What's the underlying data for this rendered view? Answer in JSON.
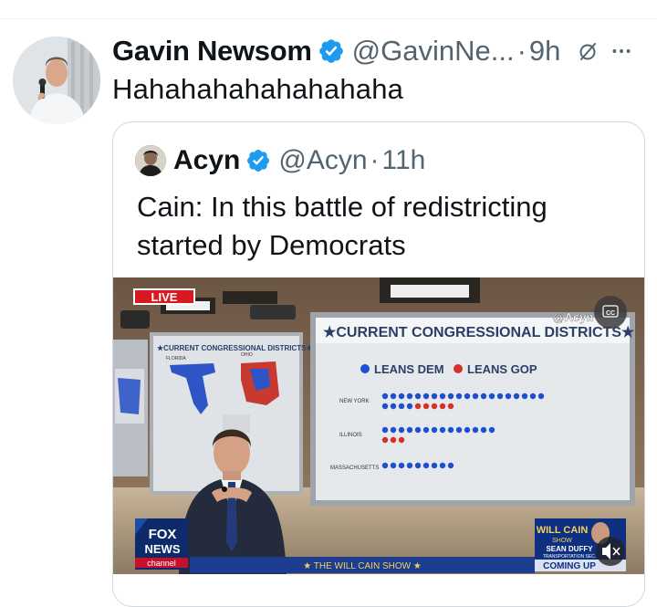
{
  "tweet": {
    "author_name": "Gavin Newsom",
    "handle": "@GavinNe...",
    "time": "9h",
    "separator": "·",
    "text": "Hahahahahahahahaha"
  },
  "quote": {
    "author_name": "Acyn",
    "handle": "@Acyn",
    "separator": "·",
    "time": "11h",
    "text": "Cain: In this battle of redistricting started by Democrats"
  },
  "media": {
    "live_badge": "LIVE",
    "board_title": "★CURRENT CONGRESSIONAL DISTRICTS★",
    "legend_dem": "LEANS DEM",
    "legend_gop": "LEANS GOP",
    "row_new_york": "NEW YORK",
    "row_illinois": "ILLINOIS",
    "row_massachusetts": "MASSACHUSETTS",
    "left_board_title": "★CURRENT CONGRESSIONAL DISTRICTS★",
    "left_board_florida": "FLORIDA",
    "left_board_ohio": "OHIO",
    "watermark": "@Acyn",
    "cc_label": "CC",
    "network_fox": "FOX",
    "network_news": "NEWS",
    "network_channel": "channel",
    "show_banner": "★ THE WILL CAIN SHOW ★",
    "promo_show_a": "WILL CAIN",
    "promo_show_b": "SHOW",
    "promo_guest": "SEAN DUFFY",
    "promo_role": "TRANSPORTATION SEC.",
    "promo_coming": "COMING UP"
  },
  "colors": {
    "verified": "#1d9bf0",
    "secondary_text": "#536471",
    "dem_blue": "#1f4fd1",
    "gop_red": "#d6302b",
    "live_red": "#d71920"
  }
}
